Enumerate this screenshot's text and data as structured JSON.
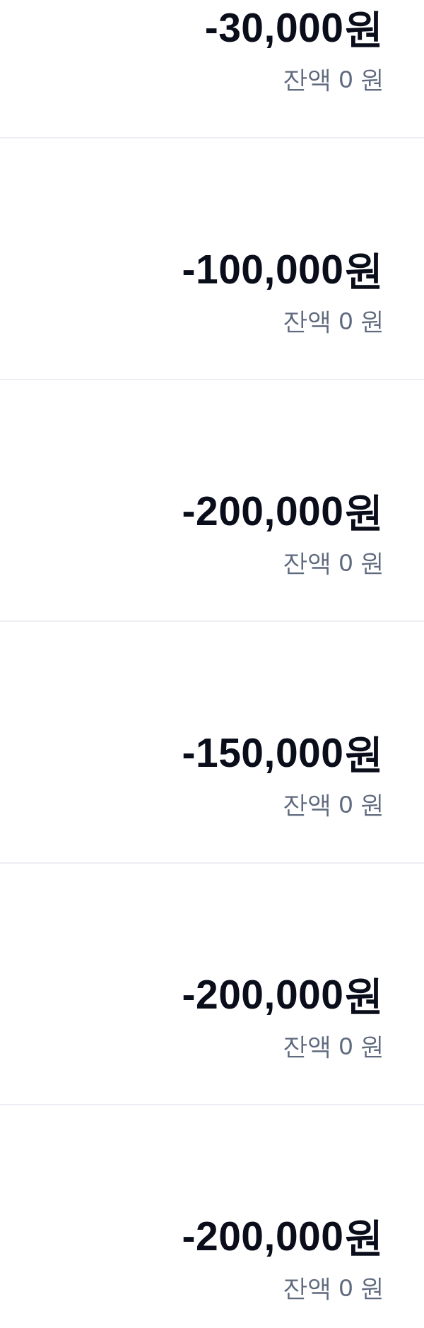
{
  "transactions": [
    {
      "amount": "-30,000원",
      "balance": "잔액 0 원"
    },
    {
      "amount": "-100,000원",
      "balance": "잔액 0 원"
    },
    {
      "amount": "-200,000원",
      "balance": "잔액 0 원"
    },
    {
      "amount": "-150,000원",
      "balance": "잔액 0 원"
    },
    {
      "amount": "-200,000원",
      "balance": "잔액 0 원"
    },
    {
      "amount": "-200,000원",
      "balance": "잔액 0 원"
    }
  ]
}
